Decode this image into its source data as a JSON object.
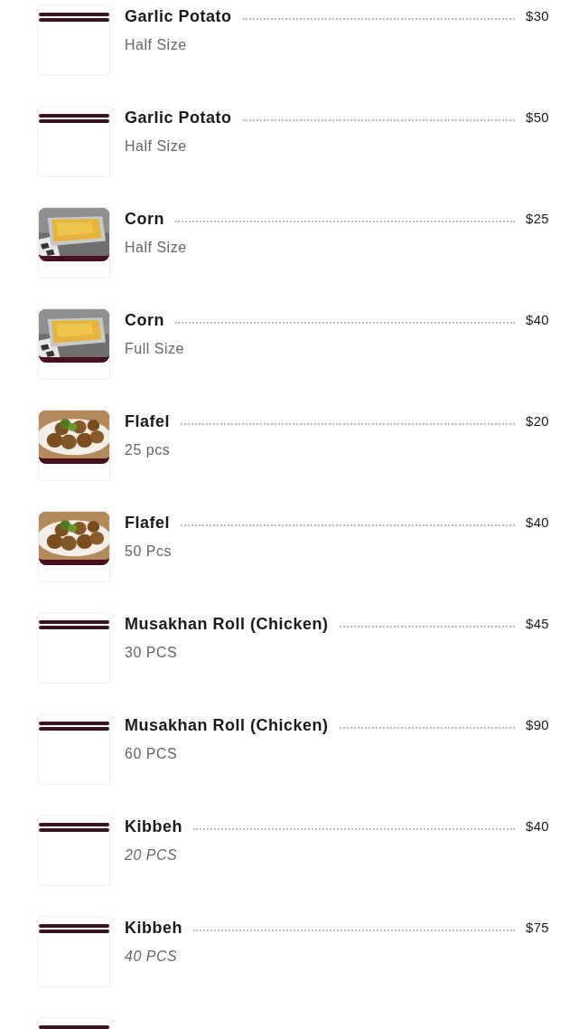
{
  "menu_items": [
    {
      "title": "Garlic Potato",
      "description": "Half Size",
      "italic": false,
      "price": "$30",
      "thumbnail": {
        "kind": "placeholder"
      }
    },
    {
      "title": "Garlic Potato",
      "description": "Half Size",
      "italic": false,
      "price": "$50",
      "thumbnail": {
        "kind": "placeholder"
      }
    },
    {
      "title": "Corn",
      "description": "Half Size",
      "italic": false,
      "price": "$25"
    },
    {
      "title": "Corn",
      "description": "Full Size",
      "italic": false,
      "price": "$40"
    },
    {
      "title": "Flafel",
      "description": "25 pcs",
      "italic": false,
      "price": "$20"
    },
    {
      "title": "Flafel",
      "description": "50 Pcs",
      "italic": false,
      "price": "$40"
    },
    {
      "title": "Musakhan Roll (Chicken)",
      "description": "30 PCS",
      "italic": false,
      "price": "$45",
      "thumbnail": {
        "kind": "placeholder"
      }
    },
    {
      "title": "Musakhan Roll (Chicken)",
      "description": "60 PCS",
      "italic": false,
      "price": "$90",
      "thumbnail": {
        "kind": "placeholder"
      }
    },
    {
      "title": "Kibbeh",
      "description": "20 PCS",
      "italic": true,
      "price": "$40",
      "thumbnail": {
        "kind": "placeholder"
      }
    },
    {
      "title": "Kibbeh",
      "description": "40 PCS",
      "italic": true,
      "price": "$75",
      "thumbnail": {
        "kind": "placeholder"
      }
    },
    {
      "thumbnail": {
        "kind": "placeholder"
      }
    }
  ]
}
